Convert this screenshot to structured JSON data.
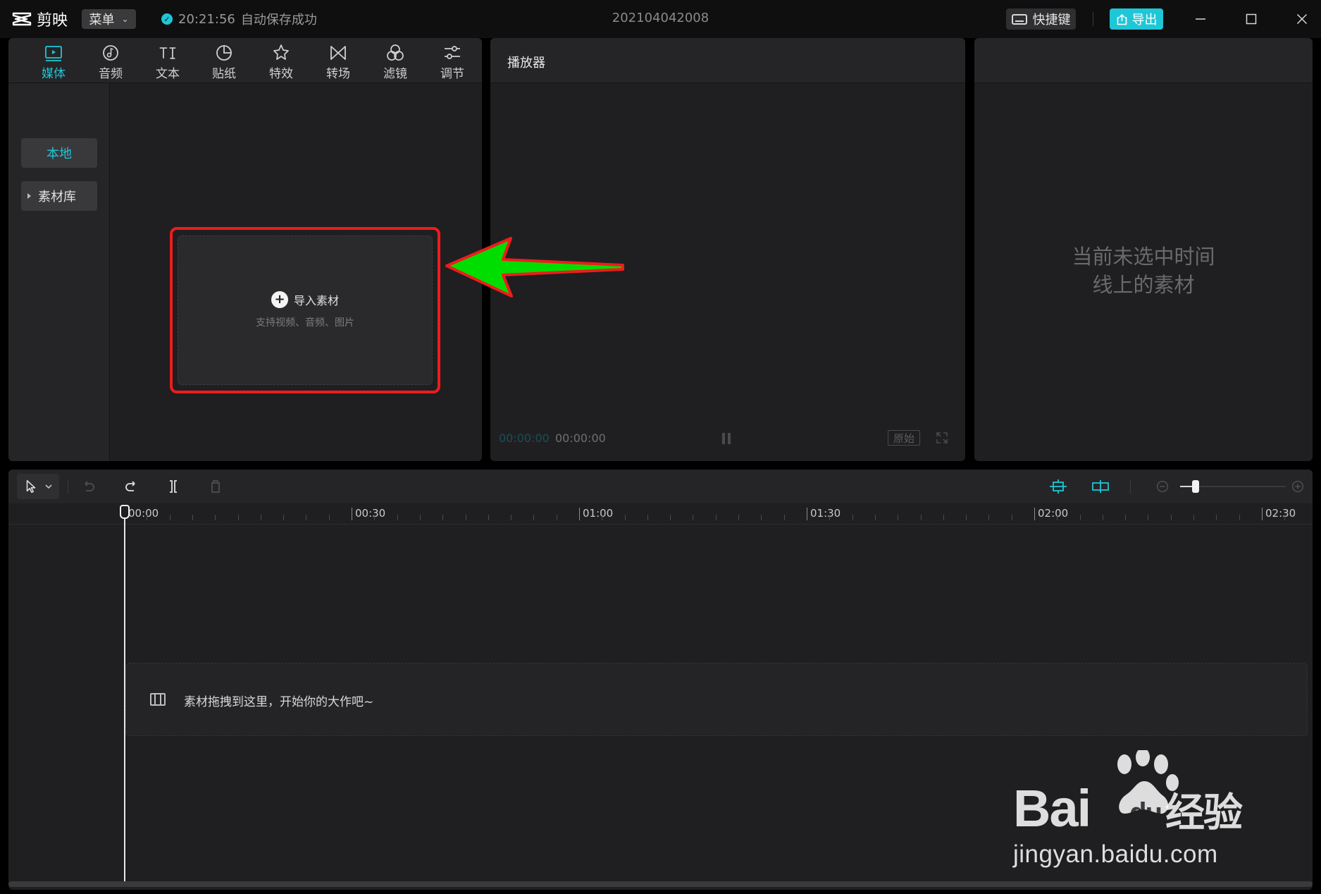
{
  "app": {
    "name": "剪映",
    "menu_label": "菜单",
    "save_time": "20:21:56",
    "save_status": "自动保存成功",
    "project_name": "202104042008",
    "hotkey_label": "快捷键",
    "export_label": "导出"
  },
  "colors": {
    "accent": "#1fc6d6",
    "highlight": "#ee1c1c",
    "arrow": "#00dd00"
  },
  "media_tabs": [
    {
      "label": "媒体",
      "icon": "media-icon",
      "active": true
    },
    {
      "label": "音频",
      "icon": "audio-icon",
      "active": false
    },
    {
      "label": "文本",
      "icon": "text-icon",
      "active": false
    },
    {
      "label": "贴纸",
      "icon": "sticker-icon",
      "active": false
    },
    {
      "label": "特效",
      "icon": "effects-icon",
      "active": false
    },
    {
      "label": "转场",
      "icon": "transition-icon",
      "active": false
    },
    {
      "label": "滤镜",
      "icon": "filter-icon",
      "active": false
    },
    {
      "label": "调节",
      "icon": "adjust-icon",
      "active": false
    }
  ],
  "media_sidebar": {
    "local": "本地",
    "library": "素材库"
  },
  "import": {
    "title": "导入素材",
    "subtitle": "支持视频、音频、图片"
  },
  "player": {
    "title": "播放器",
    "current_time": "00:00:00",
    "total_time": "00:00:00",
    "ratio_label": "原始"
  },
  "properties": {
    "empty_line1": "当前未选中时间",
    "empty_line2": "线上的素材"
  },
  "timeline": {
    "ruler_labels": [
      "00:00",
      "00:30",
      "01:00",
      "01:30",
      "02:00",
      "02:30"
    ],
    "drop_hint": "素材拖拽到这里，开始你的大作吧~"
  },
  "watermark": {
    "brand": "Bai",
    "brand_suffix": "du",
    "brand_cn": "经验",
    "url": "jingyan.baidu.com"
  }
}
